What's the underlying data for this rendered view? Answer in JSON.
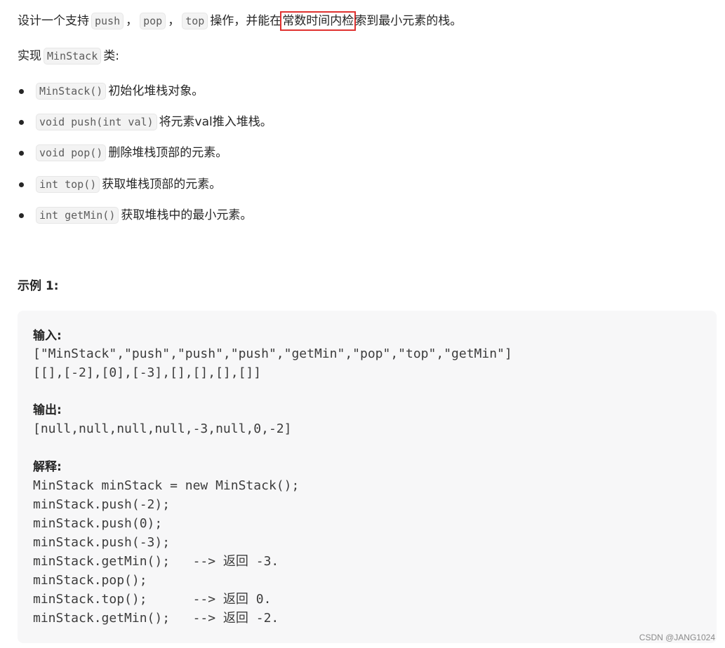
{
  "intro": {
    "prefix": "设计一个支持",
    "code1": "push",
    "sep1": "，",
    "code2": "pop",
    "sep2": "，",
    "code3": "top",
    "middle": "操作，并能在",
    "highlight": "常数时间内检",
    "suffix": "索到最小元素的栈。"
  },
  "implement": {
    "prefix": "实现",
    "code": "MinStack",
    "suffix": "类:"
  },
  "methods": [
    {
      "code": "MinStack()",
      "desc": "初始化堆栈对象。"
    },
    {
      "code": "void push(int val)",
      "desc": "将元素val推入堆栈。"
    },
    {
      "code": "void pop()",
      "desc": "删除堆栈顶部的元素。"
    },
    {
      "code": "int top()",
      "desc": "获取堆栈顶部的元素。"
    },
    {
      "code": "int getMin()",
      "desc": "获取堆栈中的最小元素。"
    }
  ],
  "example": {
    "title": "示例 1:",
    "input_label": "输入:",
    "input_line1": "[\"MinStack\",\"push\",\"push\",\"push\",\"getMin\",\"pop\",\"top\",\"getMin\"]",
    "input_line2": "[[],[-2],[0],[-3],[],[],[],[]]",
    "output_label": "输出:",
    "output_line": "[null,null,null,null,-3,null,0,-2]",
    "explain_label": "解释:",
    "explain_lines": [
      "MinStack minStack = new MinStack();",
      "minStack.push(-2);",
      "minStack.push(0);",
      "minStack.push(-3);",
      "minStack.getMin();   --> 返回 -3.",
      "minStack.pop();",
      "minStack.top();      --> 返回 0.",
      "minStack.getMin();   --> 返回 -2."
    ]
  },
  "watermark": "CSDN @JANG1024",
  "colors": {
    "highlight_border": "#e0312f",
    "code_bg": "#f3f3f3",
    "example_bg": "#f7f7f8"
  }
}
